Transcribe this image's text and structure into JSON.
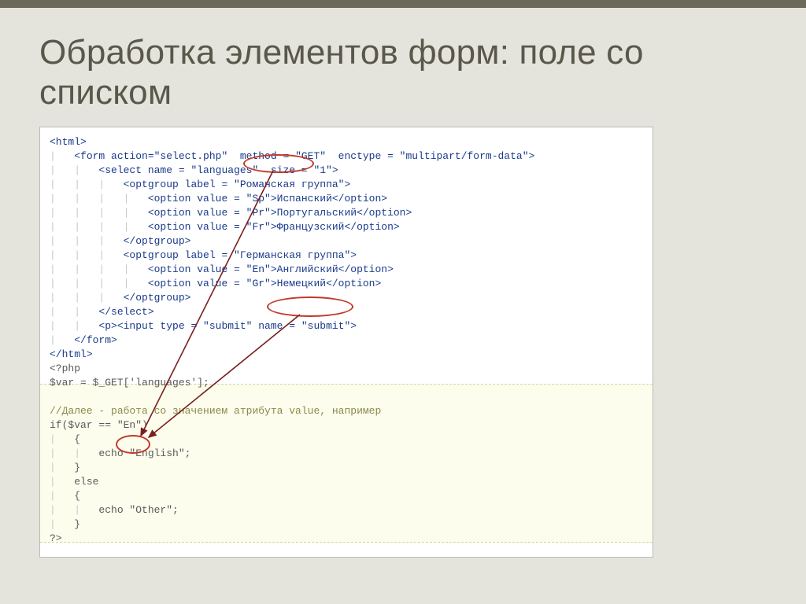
{
  "title": "Обработка элементов форм: поле со списком",
  "html_block": {
    "open": "<html>",
    "form_open": "<form action=\"select.php\"  method = \"GET\"  enctype = \"multipart/form-data\">",
    "select_open": "<select name = \"languages\"  size = \"1\">",
    "optgroup1_open": "<optgroup label = \"Романская группа\">",
    "opt_sp": "<option value = \"Sp\">Испанский</option>",
    "opt_pr": "<option value = \"Pr\">Португальский</option>",
    "opt_fr": "<option value = \"Fr\">Французский</option>",
    "optgroup_close": "</optgroup>",
    "optgroup2_open": "<optgroup label = \"Германская группа\">",
    "opt_en": "<option value = \"En\">Английский</option>",
    "opt_gr": "<option value = \"Gr\">Немецкий</option>",
    "select_close": "</select>",
    "input_submit": "<p><input type = \"submit\" name = \"submit\">",
    "form_close": "</form>",
    "close": "</html>"
  },
  "php_block": {
    "open": "<?php",
    "var": "$var = $_GET['languages'];",
    "blank": "",
    "comment": "//Далее - работа со значением атрибута value, например",
    "if": "if($var == \"En\")",
    "brace_open": "{",
    "echo_en": "echo \"English\";",
    "brace_close": "}",
    "else": "else",
    "echo_other": "echo \"Other\";",
    "close": "?>"
  }
}
